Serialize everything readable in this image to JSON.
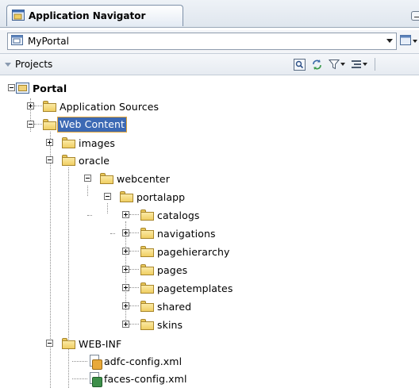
{
  "window": {
    "tab_title": "Application Navigator",
    "application": "MyPortal"
  },
  "projects_panel": {
    "label": "Projects"
  },
  "tree": {
    "root": "Portal",
    "application_sources": "Application Sources",
    "web_content": "Web Content",
    "images": "images",
    "oracle": "oracle",
    "webcenter": "webcenter",
    "portalapp": "portalapp",
    "catalogs": "catalogs",
    "navigations": "navigations",
    "pagehierarchy": "pagehierarchy",
    "pages": "pages",
    "pagetemplates": "pagetemplates",
    "shared": "shared",
    "skins": "skins",
    "web_inf": "WEB-INF",
    "adfc_config": "adfc-config.xml",
    "faces_config": "faces-config.xml"
  },
  "colors": {
    "selection": "#3c69b4",
    "folder": "#f0cf63"
  }
}
